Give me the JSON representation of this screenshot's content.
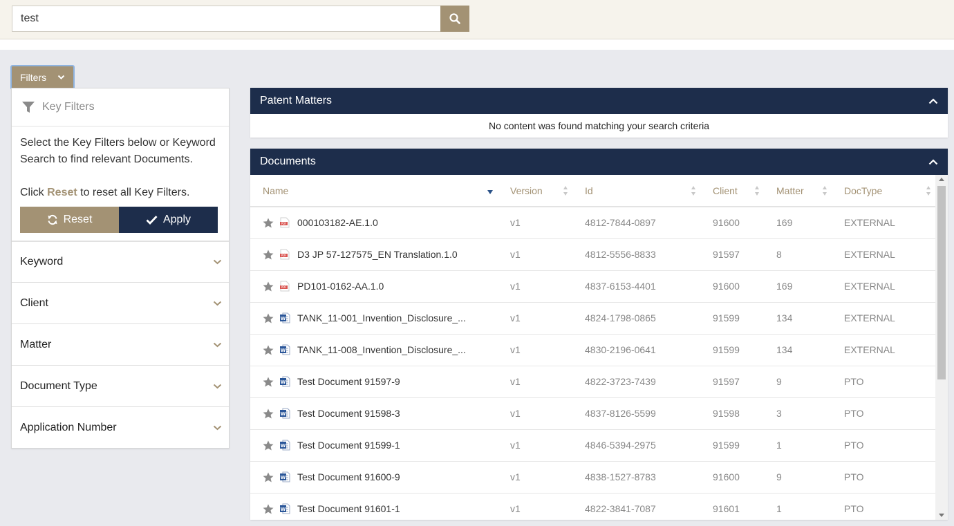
{
  "search": {
    "value": "test"
  },
  "filters_toggle": {
    "label": "Filters"
  },
  "key_filters": {
    "title": "Key Filters",
    "instructions": "Select the Key Filters below or Keyword Search to find relevant Documents.",
    "reset_hint_prefix": "Click ",
    "reset_hint_word": "Reset",
    "reset_hint_suffix": " to reset all Key Filters.",
    "reset_label": "Reset",
    "apply_label": "Apply",
    "sections": [
      {
        "label": "Keyword"
      },
      {
        "label": "Client"
      },
      {
        "label": "Matter"
      },
      {
        "label": "Document Type"
      },
      {
        "label": "Application Number"
      }
    ]
  },
  "patent_matters": {
    "title": "Patent Matters",
    "empty_message": "No content was found matching your search criteria"
  },
  "documents": {
    "title": "Documents",
    "columns": {
      "name": "Name",
      "version": "Version",
      "id": "Id",
      "client": "Client",
      "matter": "Matter",
      "doctype": "DocType"
    },
    "rows": [
      {
        "type": "pdf",
        "name": "000103182-AE.1.0",
        "version": "v1",
        "id": "4812-7844-0897",
        "client": "91600",
        "matter": "169",
        "doctype": "EXTERNAL"
      },
      {
        "type": "pdf",
        "name": "D3 JP 57-127575_EN Translation.1.0",
        "version": "v1",
        "id": "4812-5556-8833",
        "client": "91597",
        "matter": "8",
        "doctype": "EXTERNAL"
      },
      {
        "type": "pdf",
        "name": "PD101-0162-AA.1.0",
        "version": "v1",
        "id": "4837-6153-4401",
        "client": "91600",
        "matter": "169",
        "doctype": "EXTERNAL"
      },
      {
        "type": "word",
        "name": "TANK_11-001_Invention_Disclosure_...",
        "version": "v1",
        "id": "4824-1798-0865",
        "client": "91599",
        "matter": "134",
        "doctype": "EXTERNAL"
      },
      {
        "type": "word",
        "name": "TANK_11-008_Invention_Disclosure_...",
        "version": "v1",
        "id": "4830-2196-0641",
        "client": "91599",
        "matter": "134",
        "doctype": "EXTERNAL"
      },
      {
        "type": "word",
        "name": "Test Document 91597-9",
        "version": "v1",
        "id": "4822-3723-7439",
        "client": "91597",
        "matter": "9",
        "doctype": "PTO"
      },
      {
        "type": "word",
        "name": "Test Document 91598-3",
        "version": "v1",
        "id": "4837-8126-5599",
        "client": "91598",
        "matter": "3",
        "doctype": "PTO"
      },
      {
        "type": "word",
        "name": "Test Document 91599-1",
        "version": "v1",
        "id": "4846-5394-2975",
        "client": "91599",
        "matter": "1",
        "doctype": "PTO"
      },
      {
        "type": "word",
        "name": "Test Document 91600-9",
        "version": "v1",
        "id": "4838-1527-8783",
        "client": "91600",
        "matter": "9",
        "doctype": "PTO"
      },
      {
        "type": "word",
        "name": "Test Document 91601-1",
        "version": "v1",
        "id": "4822-3841-7087",
        "client": "91601",
        "matter": "1",
        "doctype": "PTO"
      }
    ]
  },
  "colors": {
    "accent": "#a39274",
    "navy": "#1d2d4b",
    "background": "#e9eaee",
    "topbar": "#f6f3ec"
  }
}
